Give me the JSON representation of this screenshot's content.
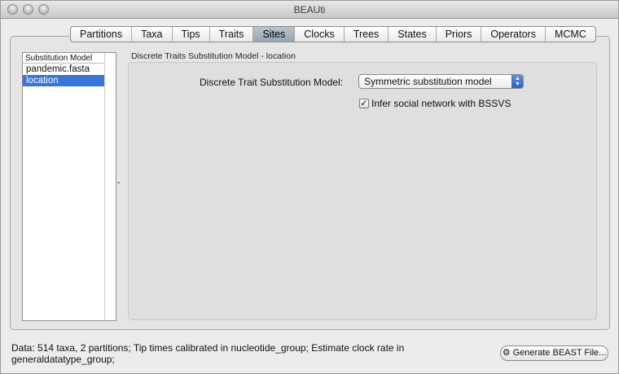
{
  "window": {
    "title": "BEAUti"
  },
  "tabs": [
    {
      "label": "Partitions",
      "selected": false
    },
    {
      "label": "Taxa",
      "selected": false
    },
    {
      "label": "Tips",
      "selected": false
    },
    {
      "label": "Traits",
      "selected": false
    },
    {
      "label": "Sites",
      "selected": true
    },
    {
      "label": "Clocks",
      "selected": false
    },
    {
      "label": "Trees",
      "selected": false
    },
    {
      "label": "States",
      "selected": false
    },
    {
      "label": "Priors",
      "selected": false
    },
    {
      "label": "Operators",
      "selected": false
    },
    {
      "label": "MCMC",
      "selected": false
    }
  ],
  "substitution_list": {
    "header": "Substitution Model",
    "items": [
      {
        "label": "pandemic.fasta",
        "selected": false
      },
      {
        "label": "location",
        "selected": true
      }
    ]
  },
  "collapse_glyph": "ˆ",
  "detail": {
    "title": "Discrete Traits Substitution Model - location",
    "model_label": "Discrete Trait Substitution Model:",
    "model_value": "Symmetric substitution model",
    "bssvs_label": "Infer social network with BSSVS",
    "bssvs_checked": true,
    "check_glyph": "✓"
  },
  "status": {
    "text": "Data: 514 taxa, 2 partitions; Tip times calibrated in nucleotide_group; Estimate clock rate in generaldatatype_group;"
  },
  "generate_button": {
    "label": "Generate BEAST File..."
  },
  "colors": {
    "selection": "#3875d7",
    "tab_selected": "#a8b3bf",
    "window_bg": "#ececec"
  }
}
